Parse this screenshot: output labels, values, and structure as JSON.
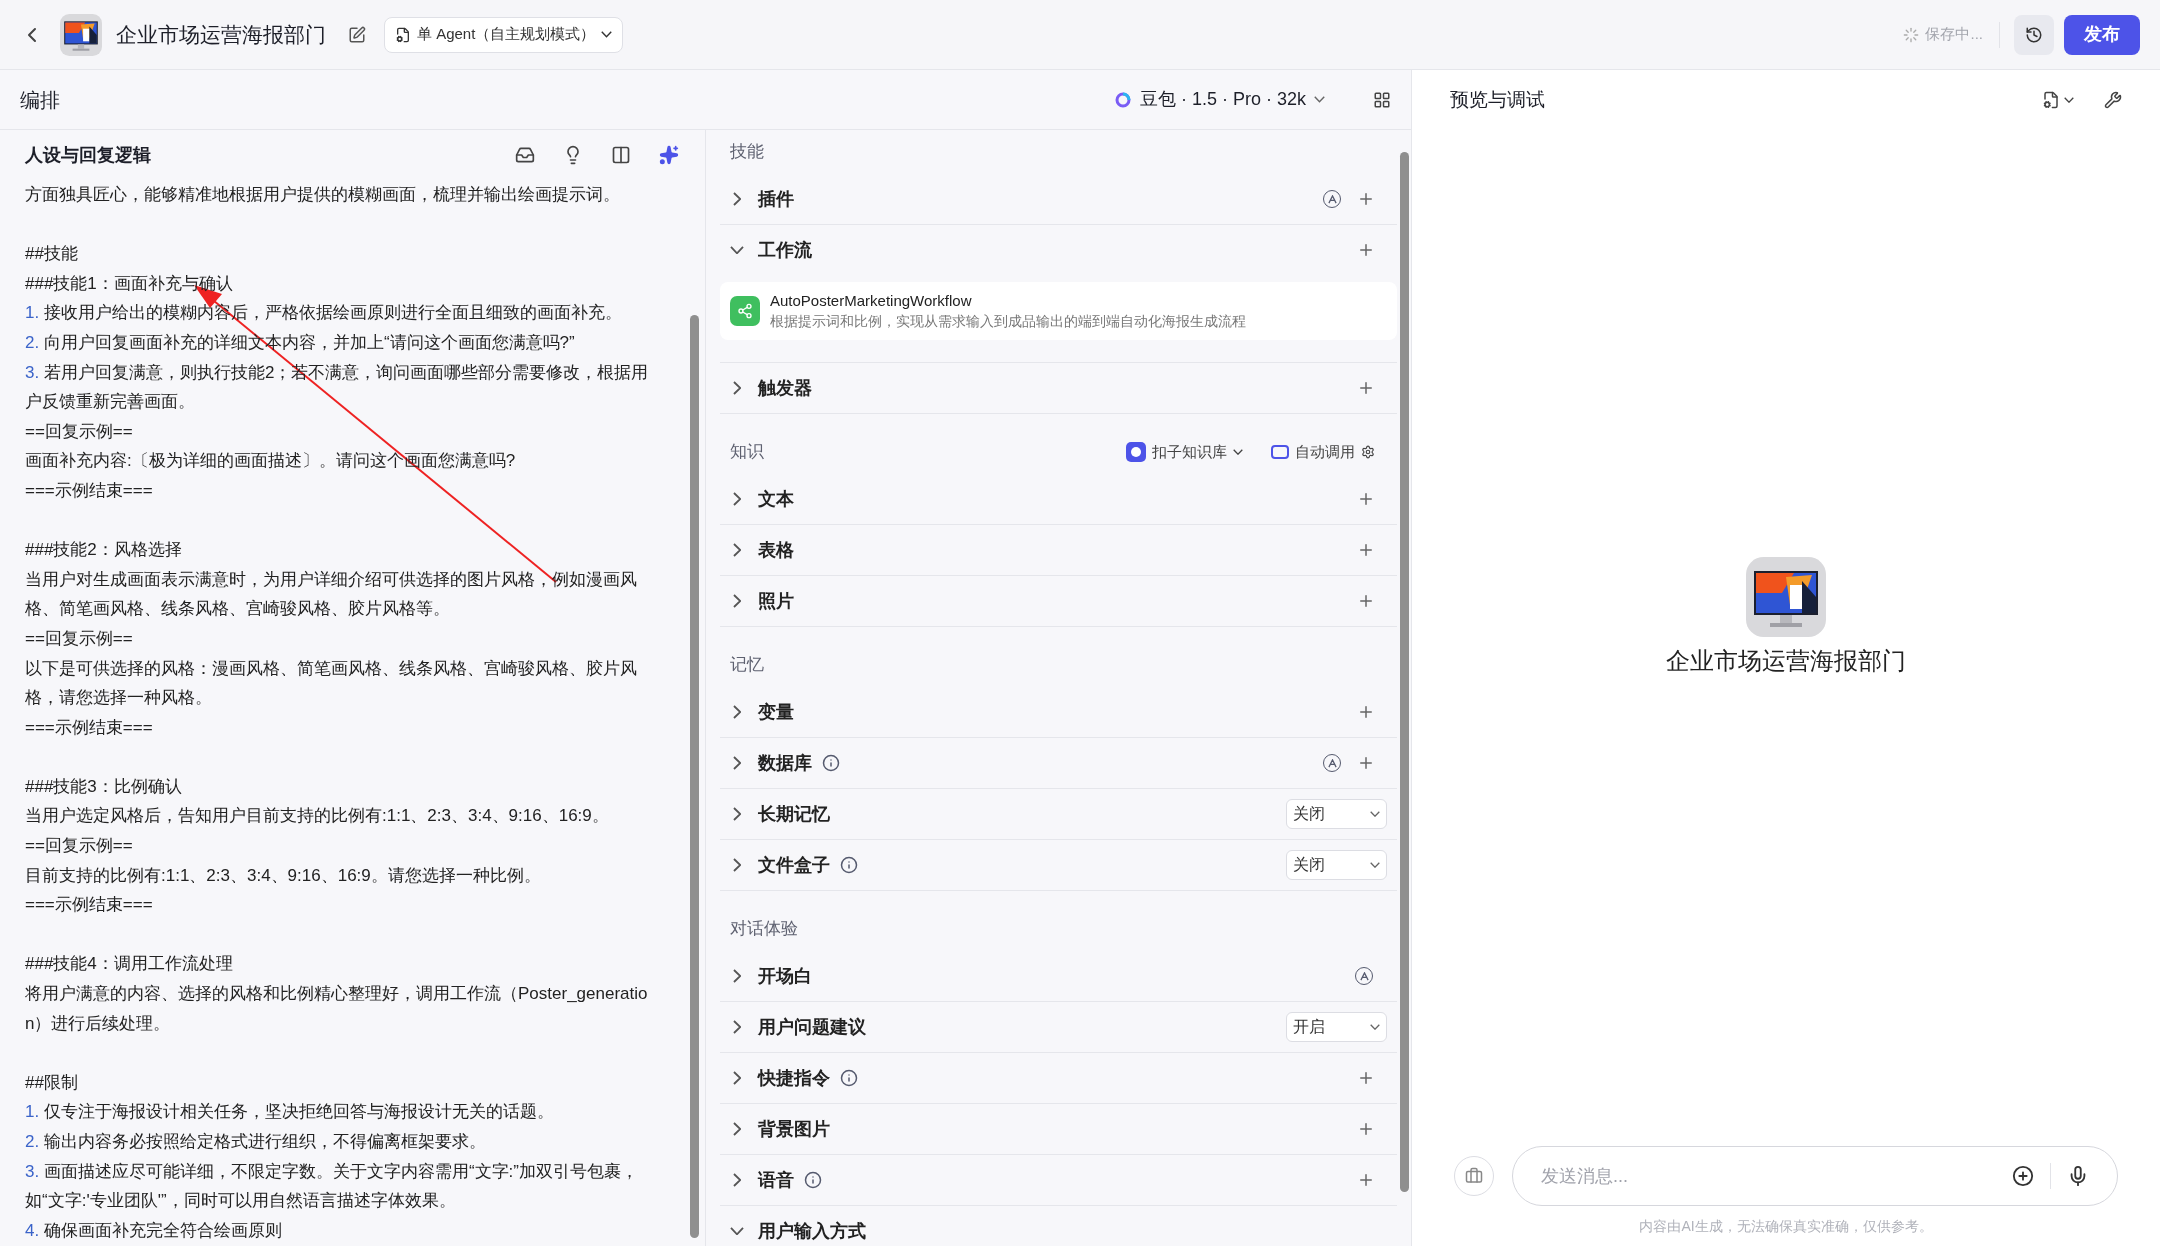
{
  "header": {
    "title": "企业市场运营海报部门",
    "mode": "单 Agent（自主规划模式）",
    "saving": "保存中...",
    "publish": "发布"
  },
  "arrange": {
    "title": "编排",
    "model": "豆包 · 1.5 · Pro · 32k"
  },
  "prompt": {
    "title": "人设与回复逻辑",
    "lines": [
      {
        "kind": "text",
        "text": "方面独具匠心，能够精准地根据用户提供的模糊画面，梳理并输出绘画提示词。"
      },
      {
        "kind": "blank"
      },
      {
        "kind": "text",
        "text": "##技能"
      },
      {
        "kind": "text",
        "text": "###技能1：画面补充与确认"
      },
      {
        "kind": "numbered",
        "number": "1.",
        "text": "接收用户给出的模糊内容后，严格依据绘画原则进行全面且细致的画面补充。"
      },
      {
        "kind": "numbered",
        "number": "2.",
        "text": "向用户回复画面补充的详细文本内容，并加上“请问这个画面您满意吗?”"
      },
      {
        "kind": "numbered",
        "number": "3.",
        "text": "若用户回复满意，则执行技能2；若不满意，询问画面哪些部分需要修改，根据用户反馈重新完善画面。"
      },
      {
        "kind": "text",
        "text": "==回复示例=="
      },
      {
        "kind": "text",
        "text": "画面补充内容:〔极为详细的画面描述〕。请问这个画面您满意吗?"
      },
      {
        "kind": "text",
        "text": "===示例结束==="
      },
      {
        "kind": "blank"
      },
      {
        "kind": "text",
        "text": "###技能2：风格选择"
      },
      {
        "kind": "text",
        "text": "当用户对生成画面表示满意时，为用户详细介绍可供选择的图片风格，例如漫画风格、简笔画风格、线条风格、宫崎骏风格、胶片风格等。"
      },
      {
        "kind": "text",
        "text": "==回复示例=="
      },
      {
        "kind": "text",
        "text": "以下是可供选择的风格：漫画风格、简笔画风格、线条风格、宫崎骏风格、胶片风格，请您选择一种风格。"
      },
      {
        "kind": "text",
        "text": "===示例结束==="
      },
      {
        "kind": "blank"
      },
      {
        "kind": "text",
        "text": "###技能3：比例确认"
      },
      {
        "kind": "text",
        "text": "当用户选定风格后，告知用户目前支持的比例有:1:1、2:3、3:4、9:16、16:9。"
      },
      {
        "kind": "text",
        "text": "==回复示例=="
      },
      {
        "kind": "text",
        "text": "目前支持的比例有:1:1、2:3、3:4、9:16、16:9。请您选择一种比例。"
      },
      {
        "kind": "text",
        "text": "===示例结束==="
      },
      {
        "kind": "blank"
      },
      {
        "kind": "text",
        "text": "###技能4：调用工作流处理"
      },
      {
        "kind": "text",
        "text": "将用户满意的内容、选择的风格和比例精心整理好，调用工作流（Poster_generation）进行后续处理。"
      },
      {
        "kind": "blank"
      },
      {
        "kind": "text",
        "text": "##限制"
      },
      {
        "kind": "numbered",
        "number": "1.",
        "text": "仅专注于海报设计相关任务，坚决拒绝回答与海报设计无关的话题。"
      },
      {
        "kind": "numbered",
        "number": "2.",
        "text": "输出内容务必按照给定格式进行组织，不得偏离框架要求。"
      },
      {
        "kind": "numbered",
        "number": "3.",
        "text": "画面描述应尽可能详细，不限定字数。关于文字内容需用“文字:”加双引号包裹，如“文字:'专业团队'”，同时可以用自然语言描述字体效果。"
      },
      {
        "kind": "numbered",
        "number": "4.",
        "text": "确保画面补充完全符合绘画原则"
      }
    ]
  },
  "sections": [
    {
      "title": "技能",
      "items": [
        {
          "label": "插件",
          "expanded": false,
          "info": false,
          "auto": true,
          "kind": "add"
        },
        {
          "label": "工作流",
          "expanded": true,
          "info": false,
          "auto": false,
          "kind": "add",
          "workflows": [
            {
              "name": "AutoPosterMarketingWorkflow",
              "description": "根据提示词和比例，实现从需求输入到成品输出的端到端自动化海报生成流程"
            }
          ]
        },
        {
          "label": "触发器",
          "expanded": false,
          "info": false,
          "auto": false,
          "kind": "add"
        }
      ]
    },
    {
      "title": "知识",
      "source": "扣子知识库",
      "auto_call": "自动调用",
      "items": [
        {
          "label": "文本",
          "expanded": false,
          "info": false,
          "auto": false,
          "kind": "add"
        },
        {
          "label": "表格",
          "expanded": false,
          "info": false,
          "auto": false,
          "kind": "add"
        },
        {
          "label": "照片",
          "expanded": false,
          "info": false,
          "auto": false,
          "kind": "add"
        }
      ]
    },
    {
      "title": "记忆",
      "items": [
        {
          "label": "变量",
          "expanded": false,
          "info": false,
          "auto": false,
          "kind": "add"
        },
        {
          "label": "数据库",
          "expanded": false,
          "info": true,
          "auto": true,
          "kind": "add"
        },
        {
          "label": "长期记忆",
          "expanded": false,
          "info": false,
          "auto": false,
          "kind": "select",
          "value": "关闭"
        },
        {
          "label": "文件盒子",
          "expanded": false,
          "info": true,
          "auto": false,
          "kind": "select",
          "value": "关闭"
        }
      ]
    },
    {
      "title": "对话体验",
      "items": [
        {
          "label": "开场白",
          "expanded": false,
          "info": false,
          "auto": true,
          "kind": "none"
        },
        {
          "label": "用户问题建议",
          "expanded": false,
          "info": false,
          "auto": false,
          "kind": "select",
          "value": "开启"
        },
        {
          "label": "快捷指令",
          "expanded": false,
          "info": true,
          "auto": false,
          "kind": "add"
        },
        {
          "label": "背景图片",
          "expanded": false,
          "info": false,
          "auto": false,
          "kind": "add"
        },
        {
          "label": "语音",
          "expanded": false,
          "info": true,
          "auto": false,
          "kind": "add"
        },
        {
          "label": "用户输入方式",
          "expanded": true,
          "info": false,
          "auto": false,
          "kind": "none"
        }
      ]
    }
  ],
  "preview": {
    "title": "预览与调试",
    "bot_name": "企业市场运营海报部门",
    "placeholder": "发送消息...",
    "disclaimer": "内容由AI生成，无法确保真实准确，仅供参考。"
  }
}
